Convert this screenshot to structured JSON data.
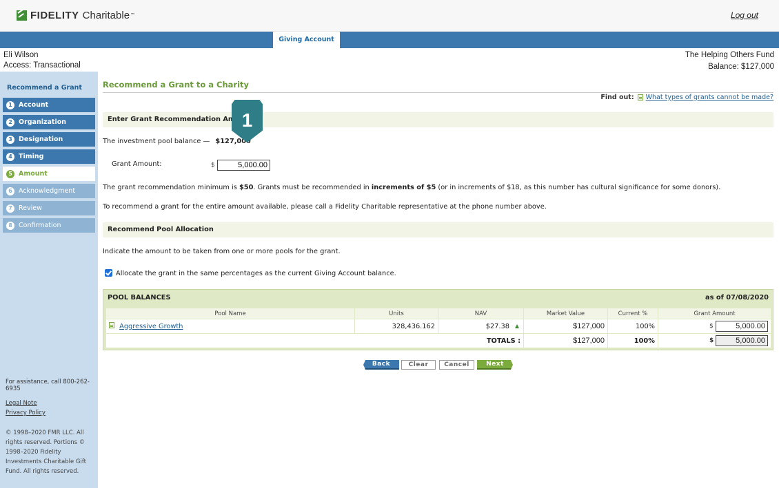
{
  "header": {
    "logo_bold": "FIDELITY",
    "logo_light": "Charitable",
    "logo_tm": "™",
    "logout_label": "Log out"
  },
  "nav": {
    "active_tab": "Giving Account"
  },
  "account": {
    "user_name": "Eli Wilson",
    "access": "Access: Transactional",
    "fund_name": "The Helping Others Fund",
    "balance": "Balance: $127,000"
  },
  "sidebar": {
    "title": "Recommend a Grant",
    "steps": [
      {
        "num": "1",
        "label": "Account",
        "state": "done"
      },
      {
        "num": "2",
        "label": "Organization",
        "state": "done"
      },
      {
        "num": "3",
        "label": "Designation",
        "state": "done"
      },
      {
        "num": "4",
        "label": "Timing",
        "state": "done"
      },
      {
        "num": "5",
        "label": "Amount",
        "state": "current"
      },
      {
        "num": "6",
        "label": "Acknowledgment",
        "state": "todo"
      },
      {
        "num": "7",
        "label": "Review",
        "state": "todo"
      },
      {
        "num": "8",
        "label": "Confirmation",
        "state": "todo"
      }
    ],
    "assistance": "For assistance, call 800-262-6935",
    "legal_note": "Legal Note",
    "privacy_policy": "Privacy Policy",
    "copyright": "© 1998–2020 FMR LLC. All rights reserved. Portions © 1998–2020 Fidelity Investments Charitable Gift Fund. All rights reserved."
  },
  "main": {
    "title": "Recommend a Grant to a Charity",
    "find_out_label": "Find out:",
    "find_out_link": "What types of grants cannot be made?",
    "section1_title": "Enter Grant Recommendation Amount",
    "pool_balance_text": "The investment pool balance —",
    "pool_balance_value": "$127,000",
    "grant_amount_label": "Grant Amount:",
    "currency_symbol": "$",
    "grant_amount_value": "5,000.00",
    "callout_number": "1",
    "minimum_text_1": "The grant recommendation minimum is ",
    "minimum_value": "$50",
    "minimum_text_2": ". Grants must be recommended in ",
    "increments_value": "increments of $5",
    "minimum_text_3": " (or in increments of $18, as this number has cultural significance for some donors).",
    "entire_amount_text": "To recommend a grant for the entire amount available, please call a Fidelity Charitable representative at the phone number above.",
    "section2_title": "Recommend Pool Allocation",
    "indicate_text": "Indicate the amount to be taken from one or more pools for the grant.",
    "allocate_checked": true,
    "allocate_label": "Allocate the grant in the same percentages as the current Giving Account balance."
  },
  "pool_table": {
    "title": "POOL BALANCES",
    "as_of": "as of 07/08/2020",
    "columns": [
      "Pool Name",
      "Units",
      "NAV",
      "Market Value",
      "Current %",
      "Grant Amount"
    ],
    "rows": [
      {
        "pool_name": "Aggressive Growth",
        "units": "328,436.162",
        "nav": "$27.38",
        "market_value": "$127,000",
        "current_pct": "100%",
        "grant_amount": "5,000.00"
      }
    ],
    "totals_label": "TOTALS :",
    "total_market_value": "$127,000",
    "total_pct": "100%",
    "total_grant_amount": "5,000.00"
  },
  "buttons": {
    "back": "Back",
    "clear": "Clear",
    "cancel": "Cancel",
    "next": "Next"
  },
  "colors": {
    "brand_blue": "#3c78ad",
    "brand_green": "#7bab3d",
    "callout_teal": "#2e7d87"
  }
}
